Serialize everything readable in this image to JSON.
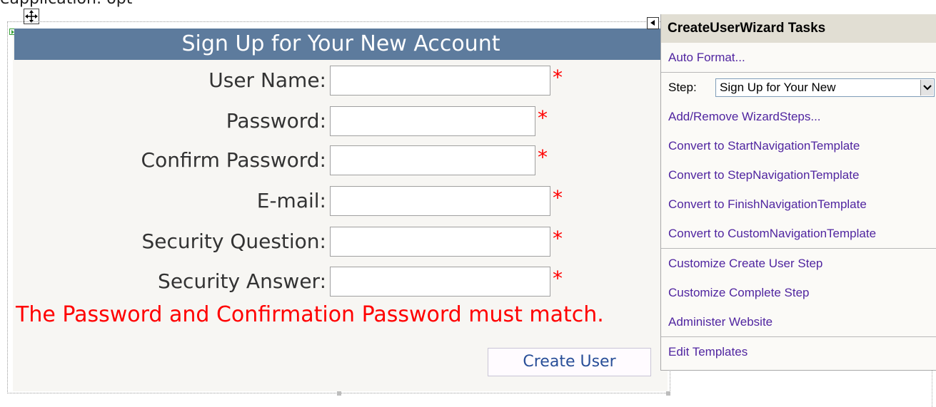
{
  "top_caption": "eapplication: opt",
  "wizard": {
    "header": "Sign Up for Your New Account",
    "fields": [
      {
        "label": "User Name:",
        "required_marker": "*"
      },
      {
        "label": "Password:",
        "required_marker": "*"
      },
      {
        "label": "Confirm Password:",
        "required_marker": "*"
      },
      {
        "label": "E-mail:",
        "required_marker": "*"
      },
      {
        "label": "Security Question:",
        "required_marker": "*"
      },
      {
        "label": "Security Answer:",
        "required_marker": "*"
      }
    ],
    "error_message": "The Password and Confirmation Password must match.",
    "create_button": "Create User"
  },
  "tasks_panel": {
    "title": "CreateUserWizard Tasks",
    "auto_format": "Auto Format...",
    "step_label": "Step:",
    "step_value": "Sign Up for Your New",
    "links_group1": [
      "Add/Remove WizardSteps...",
      "Convert to StartNavigationTemplate",
      "Convert to StepNavigationTemplate",
      "Convert to FinishNavigationTemplate",
      "Convert to CustomNavigationTemplate"
    ],
    "links_group2": [
      "Customize Create User Step",
      "Customize Complete Step",
      "Administer Website"
    ],
    "edit_templates": "Edit Templates"
  },
  "icons": {
    "move": "move-icon",
    "collapse": "collapse-arrow-icon",
    "dropdown": "chevron-down-icon",
    "marker": "green-marker-icon"
  },
  "colors": {
    "header_bg": "#5d7b9d",
    "required": "#ff0000",
    "link": "#5025a0",
    "panel_title_bg": "#e1ded3"
  }
}
